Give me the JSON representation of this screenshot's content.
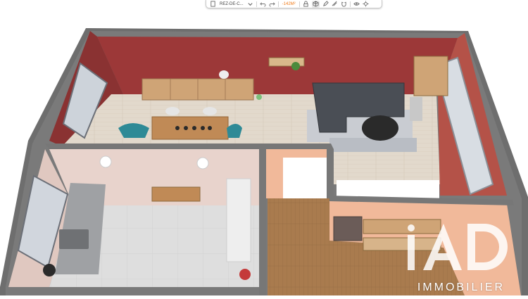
{
  "toolbar": {
    "level_label": "REZ-DE-C...",
    "area_label": "-142M²",
    "icons": [
      "pages-icon",
      "chevron-down-icon",
      "undo-icon",
      "redo-icon",
      "lock-icon",
      "3d-view-icon",
      "pencil-icon",
      "measure-icon",
      "magnet-icon",
      "eye-icon",
      "settings-icon"
    ]
  },
  "brand": {
    "name": "IMMOBILIER",
    "logo": "iAD"
  },
  "colors": {
    "accent": "#f07a18",
    "wall": "#6b6b6b",
    "living_wall": "#9c3838",
    "kitchen_wall": "#e8d3cc",
    "hall_wall": "#f1b99a",
    "wood_floor": "#a97b4e",
    "light_floor": "#e3dbd0",
    "tile_floor": "#dedede"
  }
}
